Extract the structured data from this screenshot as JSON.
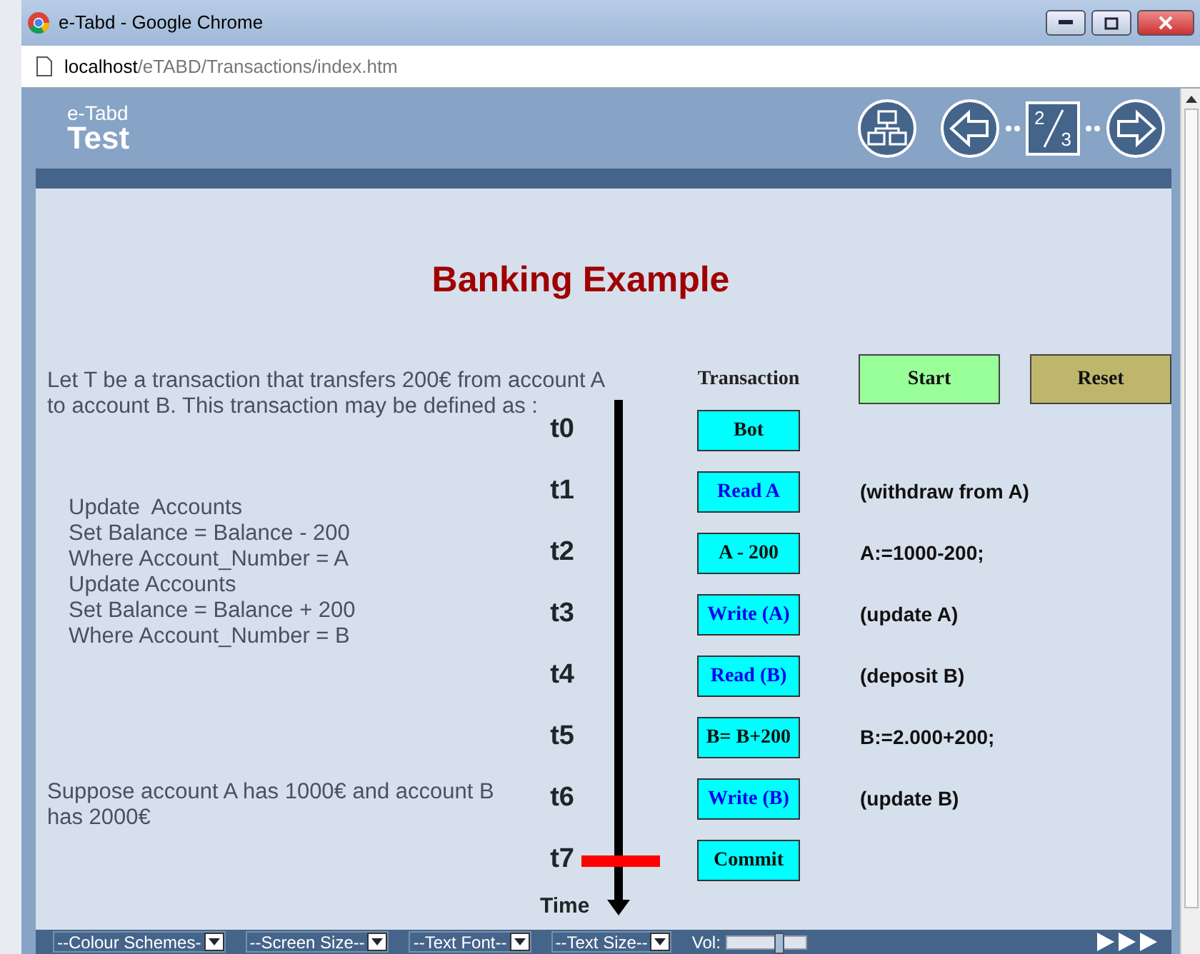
{
  "browser": {
    "title": "e-Tabd - Google Chrome",
    "url_host": "localhost",
    "url_path": "/eTABD/Transactions/index.htm"
  },
  "header": {
    "subtitle": "e-Tabd",
    "title": "Test",
    "page_numerator": "2",
    "page_denominator": "3"
  },
  "heading": "Banking Example",
  "intro": "Let T be a transaction that transfers 200€ from account A to account B. This transaction may be defined as :",
  "sql_lines": [
    "Update  Accounts",
    "Set Balance = Balance - 200",
    "Where Account_Number = A",
    "Update Accounts",
    "Set Balance = Balance + 200",
    "Where Account_Number = B"
  ],
  "note": "Suppose account A has 1000€ and account B has 2000€",
  "column_heading": "Transaction",
  "buttons": [
    {
      "label": "Start",
      "kind": "start"
    },
    {
      "label": "Reset",
      "kind": "reset"
    }
  ],
  "steps": [
    {
      "time": "t0",
      "operation": "Bot",
      "kind": "control",
      "marked": false
    },
    {
      "time": "t1",
      "operation": "Read A",
      "kind": "io",
      "description": "(withdraw from A)",
      "marked": false
    },
    {
      "time": "t2",
      "operation": "A - 200",
      "kind": "control",
      "description": "A:=1000-200;",
      "marked": false
    },
    {
      "time": "t3",
      "operation": "Write (A)",
      "kind": "io",
      "description": "(update A)",
      "marked": false
    },
    {
      "time": "t4",
      "operation": "Read (B)",
      "kind": "io",
      "description": "(deposit B)",
      "marked": false
    },
    {
      "time": "t5",
      "operation": "B= B+200",
      "kind": "control",
      "description": "B:=2.000+200;",
      "marked": false
    },
    {
      "time": "t6",
      "operation": "Write (B)",
      "kind": "io",
      "description": "(update B)",
      "marked": false
    },
    {
      "time": "t7",
      "operation": "Commit",
      "kind": "control",
      "marked": true
    }
  ],
  "time_axis_label": "Time",
  "toolbar": {
    "selects": [
      "--Colour Schemes-",
      "--Screen Size--",
      "--Text Font--",
      "--Text Size--"
    ],
    "volume_label": "Vol:",
    "volume": {
      "level": 0.66
    }
  }
}
